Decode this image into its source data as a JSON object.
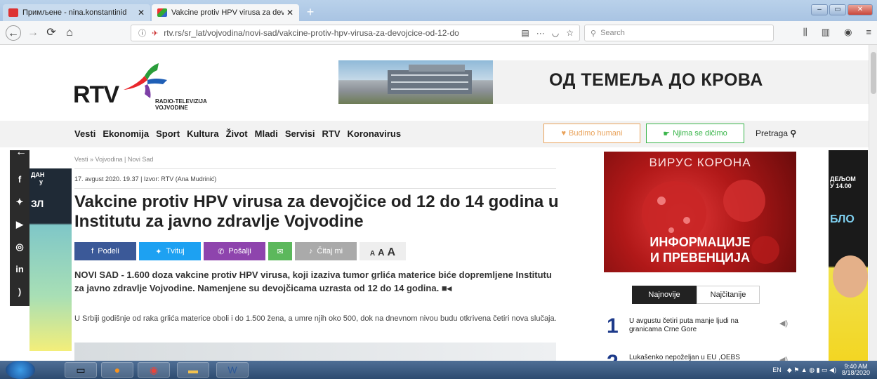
{
  "browser": {
    "tabs": [
      {
        "title": "Примљене - nina.konstantinid",
        "active": false
      },
      {
        "title": "Vakcine protiv HPV virusa za dev",
        "active": true
      }
    ],
    "url": "rtv.rs/sr_lat/vojvodina/novi-sad/vakcine-protiv-hpv-virusa-za-devojcice-od-12-do",
    "search_placeholder": "Search",
    "url_more": "···"
  },
  "site": {
    "logo_text": "RTV",
    "logo_sub1": "RADIO-TELEVIZIJA",
    "logo_sub2": "VOJVODINE",
    "banner_text": "ОД ТЕМЕЉА ДО КРОВА",
    "menu": [
      "Vesti",
      "Ekonomija",
      "Sport",
      "Kultura",
      "Život",
      "Mladi",
      "Servisi",
      "RTV",
      "Koronavirus"
    ],
    "pill_humani": "Budimo humani",
    "pill_nima": "Njima se dičimo",
    "pretraga": "Pretraga"
  },
  "article": {
    "breadcrumb": "Vesti » Vojvodina | Novi Sad",
    "meta": "17. avgust 2020. 19.37 | Izvor: RTV (Ana Mudrinić)",
    "title": "Vakcine protiv HPV virusa za devojčice od 12 do 14 godina u Institutu za javno zdravlje Vojvodine",
    "share": {
      "podeli": "Podeli",
      "tvituj": "Tvituj",
      "posalji": "Pošalji",
      "citaj": "Čitaj mi",
      "font_small": "A",
      "font_mid": "A",
      "font_large": "A"
    },
    "lead": "NOVI SAD - 1.600 doza vakcine protiv HPV virusa, koji izaziva tumor grlića materice biće dopremljene Institutu za javno zdravlje Vojvodine. Namenjene su devojčicama uzrasta od 12 do 14 godina.",
    "body": "U Srbiji godišnje od raka grlića materice oboli i do 1.500 žena, a umre njih oko 500, dok na dnevnom nivou budu otkrivena četiri nova slučaja."
  },
  "sidebar": {
    "corona_top": "ВИРУС КОРОНА",
    "corona_line1": "ИНФОРМАЦИЈЕ",
    "corona_line2": "И ПРЕВЕНЦИЈА",
    "tab_latest": "Najnovije",
    "tab_read": "Najčitanije",
    "news": [
      {
        "num": "1",
        "text": "U avgustu četiri puta manje ljudi na granicama Crne Gore"
      },
      {
        "num": "2",
        "text": "Lukašenko nepoželjan u EU ,OEBS"
      }
    ]
  },
  "peeks": {
    "left_top": "ДАН",
    "left_mid": "у",
    "left_blue": "ЗЛ",
    "right_top": "ДЕЉОМ",
    "right_time": "У 14.00",
    "right_logo": "БЛО"
  },
  "taskbar": {
    "lang": "EN",
    "time": "9:40 AM",
    "date": "8/18/2020"
  },
  "colors": {
    "facebook": "#3b5998",
    "twitter": "#1da1f2",
    "viber": "#8e44ad",
    "email": "#5cb85c",
    "read": "#aaaaaa",
    "accent_orange": "#e9a25a",
    "accent_green": "#39b54a",
    "number_blue": "#1d3a8a"
  }
}
